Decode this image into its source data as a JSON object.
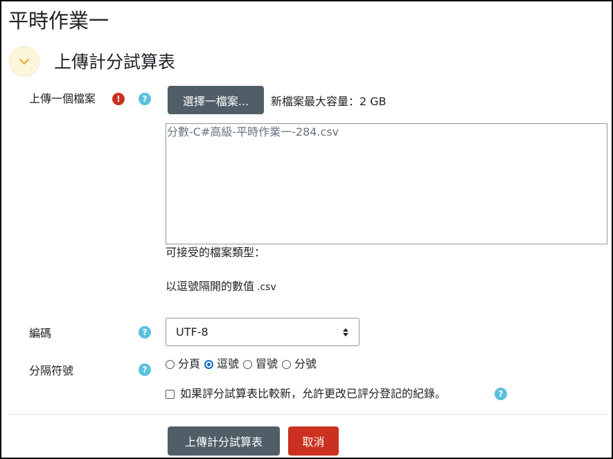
{
  "page": {
    "title": "平時作業一"
  },
  "section": {
    "title": "上傳計分試算表",
    "toggle_icon": "chevron-down-icon",
    "toggle_color": "#f0ad4e"
  },
  "upload": {
    "label": "上傳一個檔案",
    "choose_button": "選擇一檔案...",
    "max_size": "新檔案最大容量：2 GB",
    "selected_file": "分數-C#高級-平時作業一-284.csv",
    "accepted_heading": "可接受的檔案類型：",
    "accepted_type_name": "以逗號隔開的數值",
    "accepted_type_ext": ".csv"
  },
  "encoding": {
    "label": "編碼",
    "value": "UTF-8"
  },
  "separator": {
    "label": "分隔符號",
    "options": [
      "分頁",
      "逗號",
      "冒號",
      "分號"
    ],
    "selected": "逗號"
  },
  "override": {
    "label": "如果評分試算表比較新，允許更改已評分登記的紀錄。",
    "checked": false
  },
  "actions": {
    "submit": "上傳計分試算表",
    "cancel": "取消"
  },
  "colors": {
    "primary": "#4f5e67",
    "danger": "#ca3120",
    "info": "#5bc0de",
    "radio_selected": "#0f6cbf"
  }
}
